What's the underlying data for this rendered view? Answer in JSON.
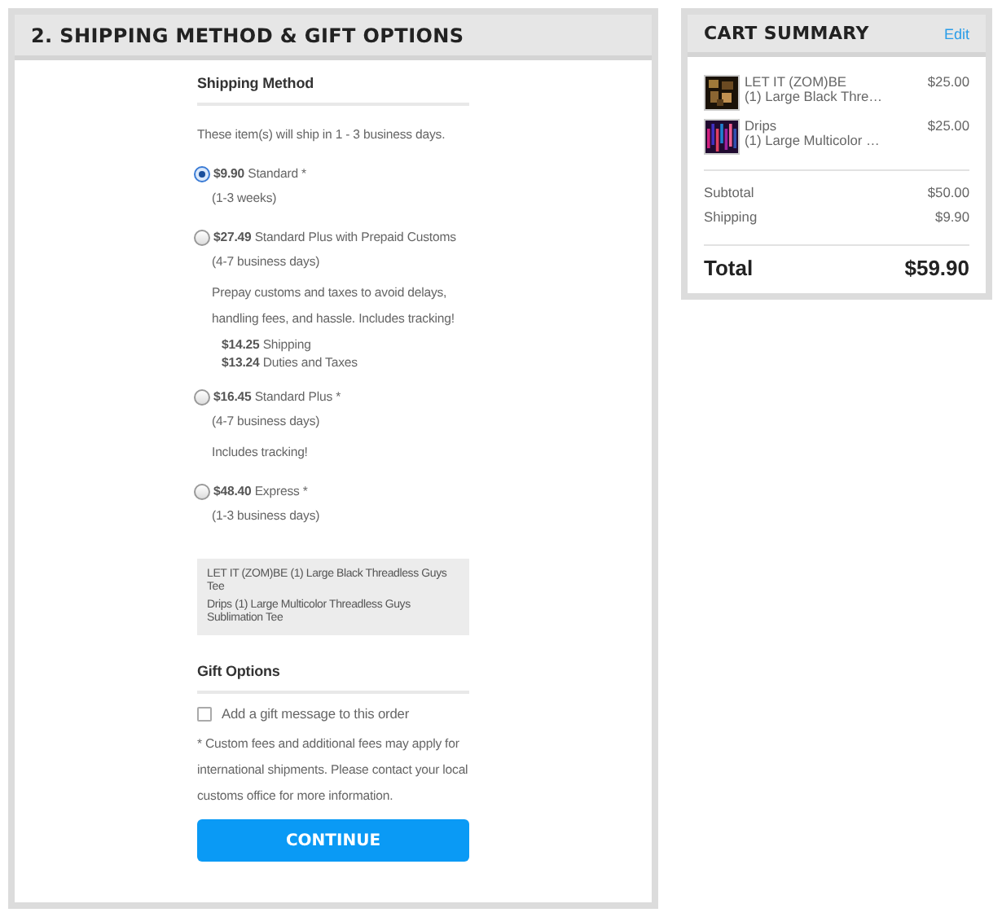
{
  "shipping_panel": {
    "title": "2. SHIPPING METHOD & GIFT OPTIONS",
    "section_title": "Shipping Method",
    "intro": "These item(s) will ship in 1 - 3 business days.",
    "options": [
      {
        "price": "$9.90",
        "name": "Standard *",
        "eta": "(1-3 weeks)",
        "selected": true
      },
      {
        "price": "$27.49",
        "name": "Standard Plus with Prepaid Customs",
        "eta": "(4-7 business days)",
        "note": "Prepay customs and taxes to avoid delays, handling fees, and hassle. Includes tracking!",
        "breakdown": [
          {
            "amount": "$14.25",
            "label": "Shipping"
          },
          {
            "amount": "$13.24",
            "label": "Duties and Taxes"
          }
        ],
        "selected": false
      },
      {
        "price": "$16.45",
        "name": "Standard Plus *",
        "eta": "(4-7 business days)",
        "note": "Includes tracking!",
        "selected": false
      },
      {
        "price": "$48.40",
        "name": "Express *",
        "eta": "(1-3 business days)",
        "selected": false
      }
    ],
    "items_summary": [
      "LET IT (ZOM)BE (1) Large Black Threadless Guys Tee",
      "Drips (1) Large Multicolor Threadless Guys Sublimation Tee"
    ],
    "gift_title": "Gift Options",
    "gift_message": {
      "label": "Add a gift message to this order",
      "checked": false
    },
    "footnote": "* Custom fees and additional fees may apply for international shipments. Please contact your local customs office for more information.",
    "continue_button": "CONTINUE"
  },
  "cart_summary": {
    "title": "CART SUMMARY",
    "edit": "Edit",
    "items": [
      {
        "name": "LET IT (ZOM)BE",
        "detail": "(1) Large Black Thre…",
        "price": "$25.00",
        "kind": "picture"
      },
      {
        "name": "Drips",
        "detail": "(1) Large Multicolor …",
        "price": "$25.00",
        "kind": "picture"
      }
    ],
    "subtotal_label": "Subtotal",
    "subtotal": "$50.00",
    "shipping_label": "Shipping",
    "shipping": "$9.90",
    "total_label": "Total",
    "total": "$59.90"
  }
}
